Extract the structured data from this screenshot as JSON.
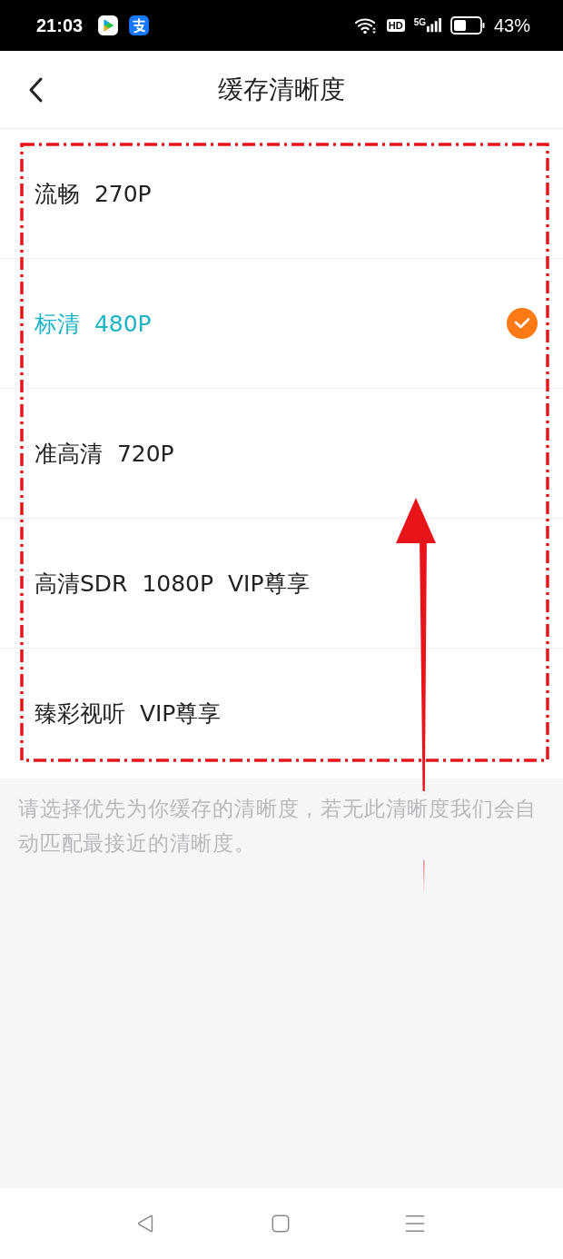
{
  "status_bar": {
    "time": "21:03",
    "hd_badge": "HD",
    "network": "5G",
    "battery": "43%"
  },
  "header": {
    "title": "缓存清晰度"
  },
  "options": [
    {
      "label": "流畅  270P",
      "selected": false
    },
    {
      "label": "标清  480P",
      "selected": true
    },
    {
      "label": "准高清  720P",
      "selected": false
    },
    {
      "label": "高清SDR  1080P  VIP尊享",
      "selected": false
    },
    {
      "label": "臻彩视听  VIP尊享",
      "selected": false
    }
  ],
  "note": "请选择优先为你缓存的清晰度，若无此清晰度我们会自动匹配最接近的清晰度。"
}
